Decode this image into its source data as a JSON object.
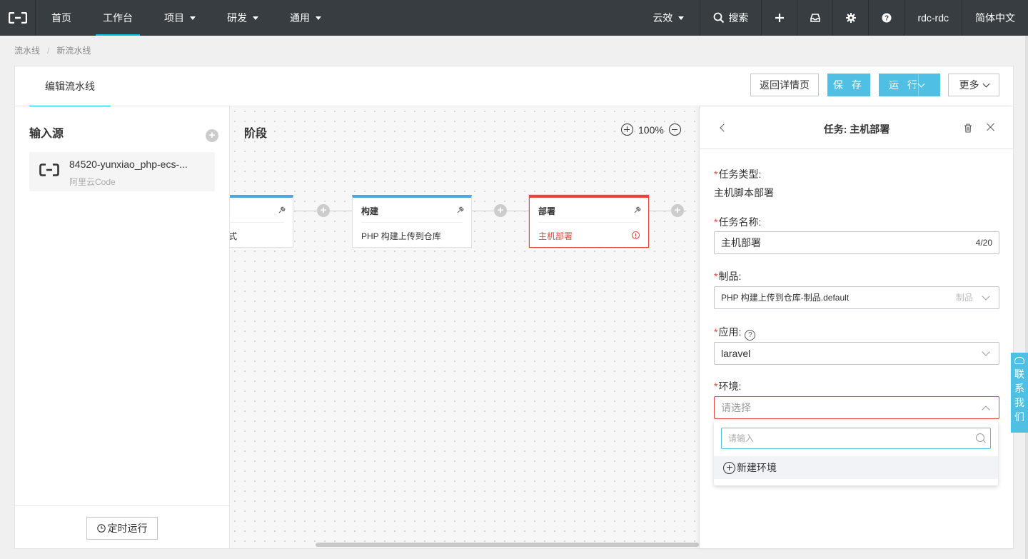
{
  "topnav": {
    "items": [
      {
        "label": "首页",
        "active": false,
        "dropdown": false
      },
      {
        "label": "工作台",
        "active": true,
        "dropdown": false
      },
      {
        "label": "项目",
        "active": false,
        "dropdown": true
      },
      {
        "label": "研发",
        "active": false,
        "dropdown": true
      },
      {
        "label": "通用",
        "active": false,
        "dropdown": true
      }
    ],
    "product": "云效",
    "search": "搜索",
    "user": "rdc-rdc",
    "language": "简体中文"
  },
  "breadcrumb": {
    "root": "流水线",
    "separator": "/",
    "current": "新流水线"
  },
  "header": {
    "tab": "编辑流水线",
    "back_button": "返回详情页",
    "save_button": "保 存",
    "run_button": "运 行",
    "more_button": "更多"
  },
  "sidebar": {
    "title": "输入源",
    "add": "+",
    "source": {
      "name": "84520-yunxiao_php-ecs-...",
      "type": "阿里云Code"
    },
    "timer_button": "定时运行"
  },
  "canvas": {
    "title": "阶段",
    "zoom": "100%",
    "stages": [
      {
        "title": "",
        "task": "式",
        "error": false
      },
      {
        "title": "构建",
        "task": "PHP 构建上传到仓库",
        "error": false
      },
      {
        "title": "部署",
        "task": "主机部署",
        "error": true
      }
    ]
  },
  "panel": {
    "title": "任务: 主机部署",
    "fields": {
      "task_type_label": "任务类型:",
      "task_type_value": "主机脚本部署",
      "task_name_label": "任务名称:",
      "task_name_value": "主机部署",
      "task_name_count": "4/20",
      "artifact_label": "制品:",
      "artifact_value": "PHP 构建上传到仓库-制品.default",
      "artifact_hint": "制品",
      "app_label": "应用:",
      "app_value": "laravel",
      "env_label": "环境:",
      "env_placeholder": "请选择"
    },
    "dropdown": {
      "search_placeholder": "请输入",
      "option": "新建环境"
    }
  },
  "contact": [
    "联",
    "系",
    "我",
    "们"
  ],
  "colors": {
    "nav_bg": "#373d41",
    "accent": "#00c1de",
    "primary_button": "#4fc0e3",
    "error": "#e84738",
    "stage_top": "#4ba7e0"
  }
}
